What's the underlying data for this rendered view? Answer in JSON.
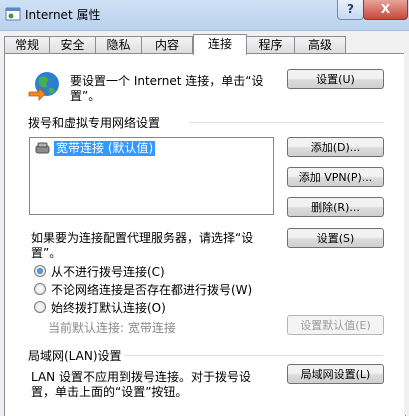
{
  "window": {
    "title": "Internet 属性",
    "help_glyph": "?",
    "close_glyph": "X"
  },
  "tabs": [
    {
      "label": "常规"
    },
    {
      "label": "安全"
    },
    {
      "label": "隐私"
    },
    {
      "label": "内容"
    },
    {
      "label": "连接",
      "active": true
    },
    {
      "label": "程序"
    },
    {
      "label": "高级"
    }
  ],
  "setup": {
    "text_line1": "要设置一个 Internet 连接，单击“设",
    "text_line2": "置”。",
    "button": "设置(U)"
  },
  "dialup": {
    "heading": "拨号和虚拟专用网络设置",
    "items": [
      {
        "label": "宽带连接 (默认值)",
        "selected": true
      }
    ],
    "add_button": "添加(D)...",
    "add_vpn_button": "添加 VPN(P)...",
    "delete_button": "删除(R)...",
    "proxy_text_line1": "如果要为连接配置代理服务器，请选择“设",
    "proxy_text_line2": "置”。",
    "settings_button": "设置(S)",
    "options": [
      {
        "label": "从不进行拨号连接(C)",
        "checked": true
      },
      {
        "label": "不论网络连接是否存在都进行拨号(W)",
        "checked": false
      },
      {
        "label": "始终拨打默认连接(O)",
        "checked": false
      }
    ],
    "current_default": "当前默认连接: 宽带连接",
    "set_default_button": "设置默认值(E)"
  },
  "lan": {
    "heading": "局域网(LAN)设置",
    "text_line1": "LAN 设置不应用到拨号连接。对于拨号设",
    "text_line2": "置，单击上面的“设置”按钮。",
    "button": "局域网设置(L)"
  },
  "colors": {
    "selection": "#3399ff",
    "title_bar": "#c3d8f1"
  }
}
